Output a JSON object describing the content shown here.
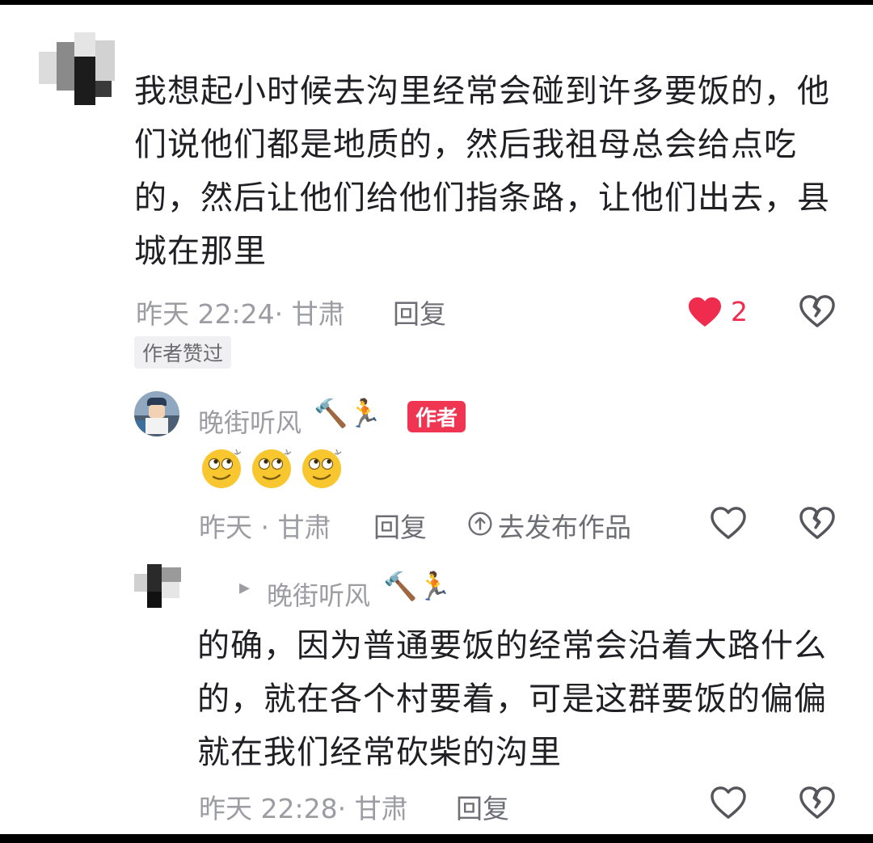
{
  "comment": {
    "text_lines": [
      "我想起小时候去沟里经常会碰到许多要饭的，他",
      "们说他们都是地质的，然后我祖母总会给点吃",
      "的，然后让他们给他们指条路，让他们出去，县",
      "城在那里"
    ],
    "meta": "昨天 22:24· 甘肃",
    "reply_label": "回复",
    "like_count": "2",
    "author_liked_badge": "作者赞过",
    "like_color": "#f02c4e"
  },
  "author_reply": {
    "username": "晚街听风",
    "user_emojis": "🔨🏃",
    "author_badge": "作者",
    "emoji_content": [
      "rolling-eyes-emoji",
      "rolling-eyes-emoji",
      "rolling-eyes-emoji"
    ],
    "meta": "昨天 · 甘肃",
    "reply_label": "回复",
    "publish_label": "去发布作品"
  },
  "nested_reply": {
    "reply_to_arrow": "▸",
    "reply_to_user": "晚街听风",
    "user_emojis": "🔨🏃",
    "text_lines": [
      "的确，因为普通要饭的经常会沿着大路什么",
      "的，就在各个村要着，可是这群要饭的偏偏",
      "就在我们经常砍柴的沟里"
    ],
    "meta": "昨天 22:28· 甘肃",
    "reply_label": "回复"
  }
}
